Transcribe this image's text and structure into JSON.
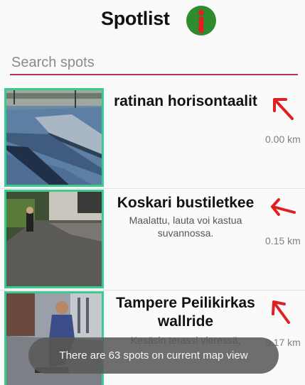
{
  "header": {
    "title": "Spotlist",
    "info_icon": "info-icon",
    "info_icon_color": "#2e8b2e",
    "info_icon_glyph_color": "#e01f1f"
  },
  "search": {
    "value": "",
    "placeholder": "Search spots",
    "underline_color": "#b0336e"
  },
  "spots": [
    {
      "title": "ratinan horisontaalit",
      "description": "",
      "distance": "0.00 km",
      "direction_icon": "arrow-up-left-icon"
    },
    {
      "title": "Koskari bustiletkee",
      "description": "Maalattu, lauta voi kastua suvannossa.",
      "distance": "0.15 km",
      "direction_icon": "arrow-left-icon"
    },
    {
      "title": "Tampere Peilikirkas wallride",
      "description": "Kesäsin terassi vieressä,",
      "distance": "0.17 km",
      "direction_icon": "arrow-up-left-icon"
    }
  ],
  "toast": {
    "message": "There are 63 spots on current map view"
  },
  "colors": {
    "thumb_border": "#3bcb8f",
    "arrow": "#e02020"
  }
}
